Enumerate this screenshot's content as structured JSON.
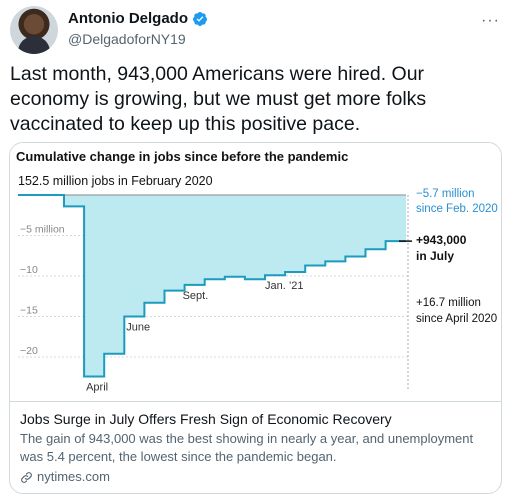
{
  "tweet": {
    "author_name": "Antonio Delgado",
    "author_handle": "@DelgadoforNY19",
    "text": "Last month, 943,000 Americans were hired. Our economy is growing, but we must get more folks vaccinated to keep up this positive pace."
  },
  "card": {
    "headline": "Jobs Surge in July Offers Fresh Sign of Economic Recovery",
    "description": "The gain of 943,000 was the best showing in nearly a year, and unemployment was 5.4 percent, the lowest since the pandemic began.",
    "domain": "nytimes.com"
  },
  "icons": {
    "verified": "verified-badge-icon",
    "more": "more-options-icon",
    "link": "link-icon"
  },
  "colors": {
    "verified": "#1d9bf0",
    "chart_fill": "#bde9f1",
    "chart_line": "#1b9bbd",
    "annotation_blue": "#2a8fd1"
  },
  "chart_data": {
    "type": "area",
    "title": "Cumulative change in jobs since before the pandemic",
    "baseline_label": "152.5 million jobs in February 2020",
    "x": [
      "Feb 2020",
      "Mar 2020",
      "Apr 2020",
      "May 2020",
      "Jun 2020",
      "Jul 2020",
      "Aug 2020",
      "Sep 2020",
      "Oct 2020",
      "Nov 2020",
      "Dec 2020",
      "Jan 2021",
      "Feb 2021",
      "Mar 2021",
      "Apr 2021",
      "May 2021",
      "Jun 2021",
      "Jul 2021"
    ],
    "values": [
      0,
      -1.4,
      -22.4,
      -19.6,
      -15.0,
      -13.3,
      -11.8,
      -11.1,
      -10.4,
      -10.1,
      -10.4,
      -9.9,
      -9.5,
      -8.7,
      -8.2,
      -7.6,
      -6.7,
      -5.7
    ],
    "ylim": [
      -23,
      0
    ],
    "y_ticks": [
      {
        "value": -5,
        "label": "−5 million"
      },
      {
        "value": -10,
        "label": "−10"
      },
      {
        "value": -15,
        "label": "−15"
      },
      {
        "value": -20,
        "label": "−20"
      }
    ],
    "labels": [
      {
        "x": "Apr 2020",
        "text": "April"
      },
      {
        "x": "Jun 2020",
        "text": "June"
      },
      {
        "x": "Sep 2020",
        "text": "Sept."
      },
      {
        "x": "Jan 2021",
        "text": "Jan. ’21"
      }
    ],
    "annotations": {
      "since_feb": [
        "−5.7 million",
        "since Feb. 2020"
      ],
      "july": [
        "+943,000",
        "in July"
      ],
      "since_april": [
        "+16.7 million",
        "since April 2020"
      ]
    }
  }
}
